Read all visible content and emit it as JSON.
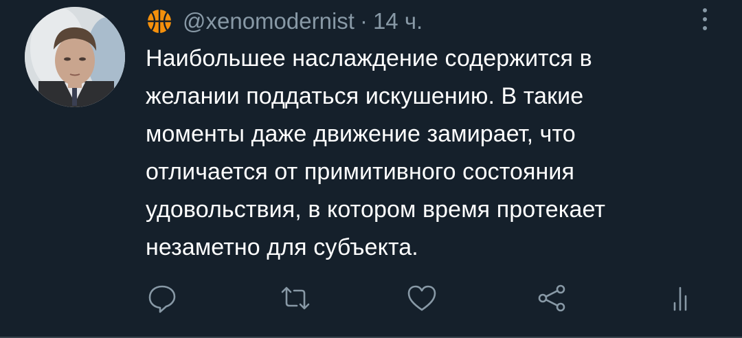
{
  "tweet": {
    "username": "@xenomodernist",
    "separator": "·",
    "time": "14 ч.",
    "text_lines": [
      "Наибольшее наслаждение содержится в",
      "желании поддаться искушению. В такие",
      "моменты даже движение замирает, что",
      "отличается от примитивного состояния",
      "удовольствия, в котором время протекает",
      "незаметно для субъекта."
    ],
    "name_icon": "basketball-icon",
    "avatar": "profile-avatar"
  },
  "actions": [
    {
      "name": "reply",
      "icon": "reply-icon"
    },
    {
      "name": "retweet",
      "icon": "retweet-icon"
    },
    {
      "name": "like",
      "icon": "heart-icon"
    },
    {
      "name": "share",
      "icon": "share-icon"
    },
    {
      "name": "analytics",
      "icon": "analytics-icon"
    }
  ],
  "colors": {
    "background": "#15202b",
    "text": "#ffffff",
    "secondary": "#8899a6",
    "accent_orange": "#f4900c"
  }
}
